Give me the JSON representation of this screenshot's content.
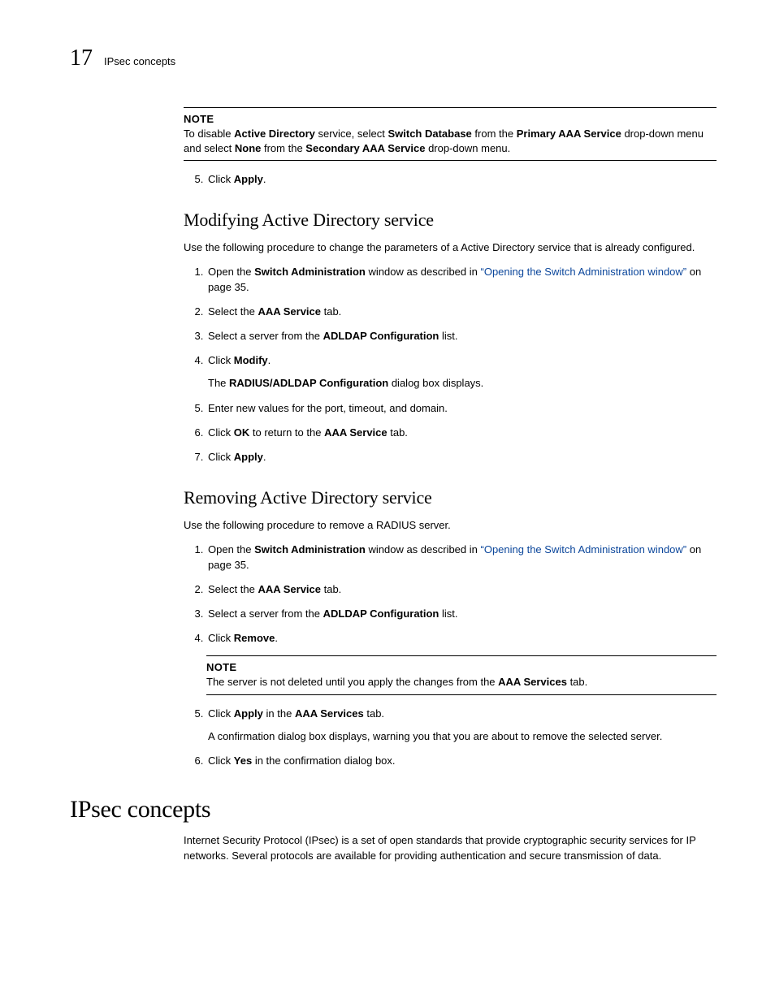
{
  "header": {
    "chapter_number": "17",
    "running_title": "IPsec concepts"
  },
  "note1": {
    "label": "NOTE",
    "t1": "To disable ",
    "b1": "Active Directory",
    "t2": " service, select ",
    "b2": "Switch Database",
    "t3": " from the ",
    "b3": "Primary AAA Service",
    "t4": " drop-down menu and select ",
    "b4": "None",
    "t5": " from the ",
    "b5": "Secondary AAA Service",
    "t6": " drop-down menu."
  },
  "step_apply_5": {
    "t1": "Click ",
    "b1": "Apply",
    "t2": "."
  },
  "h_modify": "Modifying Active Directory service",
  "p_modify_intro": "Use the following procedure to change the parameters of a Active Directory service that is already configured.",
  "m1": {
    "t1": "Open the ",
    "b1": "Switch Administration",
    "t2": " window as described in ",
    "l1": "“Opening the Switch Administration window”",
    "t3": " on page 35."
  },
  "m2": {
    "t1": "Select the ",
    "b1": "AAA Service",
    "t2": " tab."
  },
  "m3": {
    "t1": "Select a server from the ",
    "b1": "ADLDAP Configuration",
    "t2": " list."
  },
  "m4": {
    "t1": "Click ",
    "b1": "Modify",
    "t2": ".",
    "sub_t1": "The ",
    "sub_b1": "RADIUS/ADLDAP Configuration",
    "sub_t2": " dialog box displays."
  },
  "m5": {
    "t1": "Enter new values for the port, timeout, and domain."
  },
  "m6": {
    "t1": "Click ",
    "b1": "OK",
    "t2": " to return to the ",
    "b2": "AAA Service",
    "t3": " tab."
  },
  "m7": {
    "t1": "Click ",
    "b1": "Apply",
    "t2": "."
  },
  "h_remove": "Removing Active Directory service",
  "p_remove_intro": "Use the following procedure to remove a RADIUS server.",
  "r1": {
    "t1": "Open the ",
    "b1": "Switch Administration",
    "t2": " window as described in ",
    "l1": "“Opening the Switch Administration window”",
    "t3": " on page 35."
  },
  "r2": {
    "t1": "Select the ",
    "b1": "AAA Service",
    "t2": " tab."
  },
  "r3": {
    "t1": "Select a server from the ",
    "b1": "ADLDAP Configuration",
    "t2": " list."
  },
  "r4": {
    "t1": "Click ",
    "b1": "Remove",
    "t2": "."
  },
  "note2": {
    "label": "NOTE",
    "t1": "The server is not deleted until you apply the changes from the ",
    "b1": "AAA Services",
    "t2": " tab."
  },
  "r5": {
    "t1": "Click ",
    "b1": "Apply",
    "t2": " in the ",
    "b2": "AAA Services",
    "t3": " tab.",
    "sub": "A confirmation dialog box displays, warning you that you are about to remove the selected server."
  },
  "r6": {
    "t1": "Click ",
    "b1": "Yes",
    "t2": " in the confirmation dialog box."
  },
  "h_ipsec": "IPsec concepts",
  "p_ipsec": "Internet Security Protocol (IPsec) is a set of open standards that provide cryptographic security services for IP networks. Several protocols are available for providing authentication and secure transmission of data."
}
